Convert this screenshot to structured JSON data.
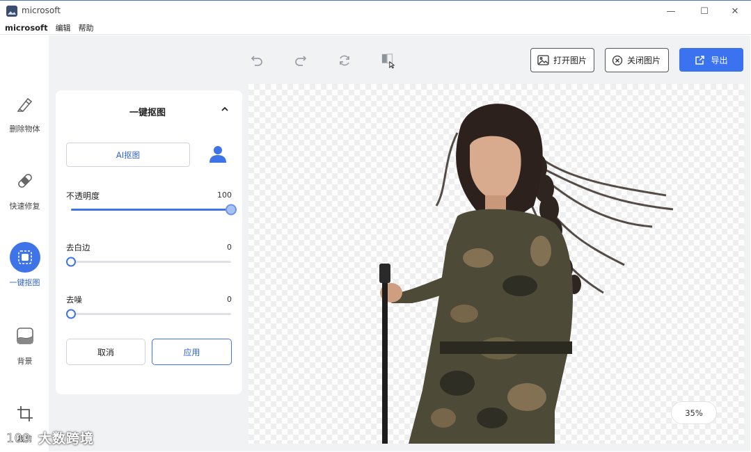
{
  "window": {
    "title": "microsoft",
    "controls": {
      "minimize": "—",
      "maximize": "☐",
      "close": "✕"
    }
  },
  "menu": {
    "brand": "microsoft",
    "items": [
      "编辑",
      "帮助"
    ]
  },
  "sidebar": {
    "items": [
      {
        "label": "删除物体",
        "icon": "eraser-icon",
        "active": false
      },
      {
        "label": "快速修复",
        "icon": "bandage-icon",
        "active": false
      },
      {
        "label": "一键抠图",
        "icon": "cutout-icon",
        "active": true
      },
      {
        "label": "背景",
        "icon": "image-background-icon",
        "active": false
      },
      {
        "label": "裁剪",
        "icon": "crop-icon",
        "active": false
      }
    ]
  },
  "toolbar": {
    "tools": [
      "undo-icon",
      "redo-icon",
      "reset-icon",
      "compare-icon"
    ],
    "open_label": "打开图片",
    "close_label": "关闭图片",
    "export_label": "导出"
  },
  "panel": {
    "title": "一键抠图",
    "ai_button": "AI抠图",
    "sliders": [
      {
        "label": "不透明度",
        "value": "100",
        "fraction": 1.0
      },
      {
        "label": "去白边",
        "value": "0",
        "fraction": 0.0
      },
      {
        "label": "去噪",
        "value": "0",
        "fraction": 0.0
      }
    ],
    "cancel_label": "取消",
    "apply_label": "应用"
  },
  "canvas": {
    "zoom": "35%"
  },
  "watermark": {
    "text": "大数跨境"
  },
  "colors": {
    "accent": "#3e74e8",
    "export_bg": "#3a72ef",
    "workspace_bg": "#f1f2f4"
  }
}
